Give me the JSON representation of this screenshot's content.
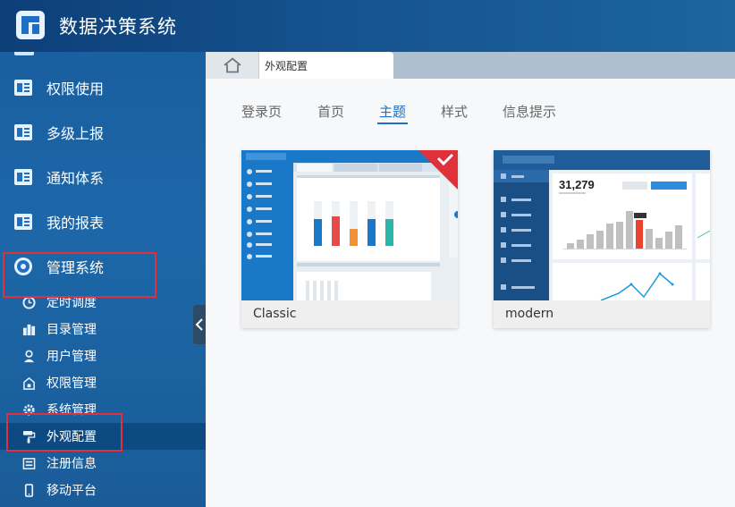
{
  "app": {
    "title": "数据决策系统"
  },
  "sidebar": {
    "main_items": [
      {
        "label": "权限使用"
      },
      {
        "label": "多级上报"
      },
      {
        "label": "通知体系"
      },
      {
        "label": "我的报表"
      },
      {
        "label": "管理系统"
      }
    ],
    "sub_items": [
      {
        "label": "定时调度"
      },
      {
        "label": "目录管理"
      },
      {
        "label": "用户管理"
      },
      {
        "label": "权限管理"
      },
      {
        "label": "系统管理"
      },
      {
        "label": "外观配置",
        "active": true
      },
      {
        "label": "注册信息"
      },
      {
        "label": "移动平台"
      }
    ]
  },
  "tabs": {
    "open_tab": "外观配置"
  },
  "subtabs": {
    "items": [
      "登录页",
      "首页",
      "主题",
      "样式",
      "信息提示"
    ],
    "active": "主题"
  },
  "themes": [
    {
      "name": "Classic",
      "selected": true
    },
    {
      "name": "modern",
      "selected": false
    }
  ],
  "modern_preview": {
    "big_number": "31,279"
  },
  "colors": {
    "accent": "#1e6fc7",
    "highlight_box": "#e0303a",
    "selected_badge": "#e0303a"
  }
}
